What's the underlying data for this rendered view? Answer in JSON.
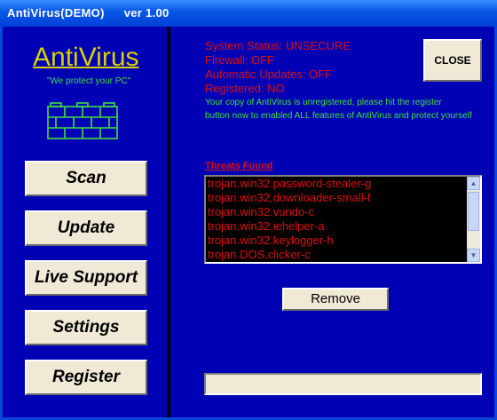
{
  "window": {
    "title": "AntiVirus(DEMO)",
    "version": "ver 1.00"
  },
  "brand": {
    "logo": "AntiVirus",
    "tagline": "\"We protect your PC\"",
    "logo_color": "#d8d000",
    "icon": "brick-wall-icon"
  },
  "nav": {
    "scan": "Scan",
    "update": "Update",
    "live_support": "Live Support",
    "settings": "Settings",
    "register": "Register"
  },
  "status": {
    "system": "System Status: UNSECURE",
    "firewall": "Firewall: OFF",
    "auto_updates": "Automatic Updates: OFF",
    "registered": "Registered: NO",
    "note_line1": "Your copy of AntiVirus is unregistered, please hit the register",
    "note_line2": "button now to enabled ALL features of AntiVirus and protect yourself",
    "alert_color": "#e01010"
  },
  "close_label": "CLOSE",
  "threats": {
    "label": "Threats Found",
    "items": [
      "trojan.win32.password-stealer-g",
      "trojan.win32.downloader-small-f",
      "trojan.win32.vundo-c",
      "trojan.win32.iehelper-a",
      "trojan.win32.keylogger-h",
      "trojan.DOS.clicker-c"
    ]
  },
  "remove_label": "Remove",
  "progress": {
    "value": 0
  }
}
